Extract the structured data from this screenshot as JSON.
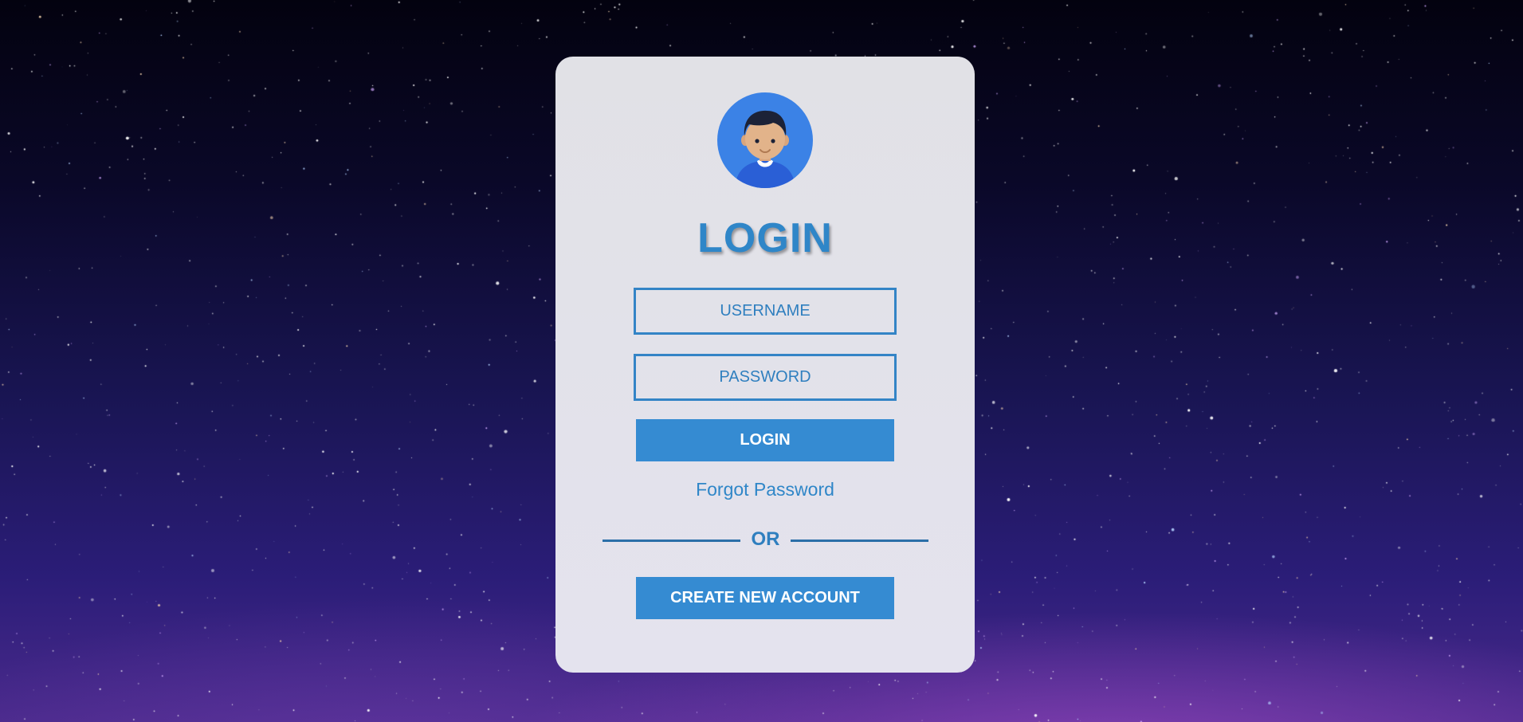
{
  "background": {
    "type": "starry-night-sky",
    "colors": [
      "#03020f",
      "#191553",
      "#4a2a8c"
    ]
  },
  "login_card": {
    "avatar": {
      "icon": "user-avatar-icon",
      "background_color": "#3b82e6"
    },
    "title": "LOGIN",
    "username_field": {
      "placeholder": "USERNAME",
      "value": ""
    },
    "password_field": {
      "placeholder": "PASSWORD",
      "value": ""
    },
    "login_button_label": "LOGIN",
    "forgot_password_label": "Forgot Password",
    "divider_label": "OR",
    "create_account_button_label": "CREATE NEW ACCOUNT",
    "accent_color": "#358bd2"
  }
}
